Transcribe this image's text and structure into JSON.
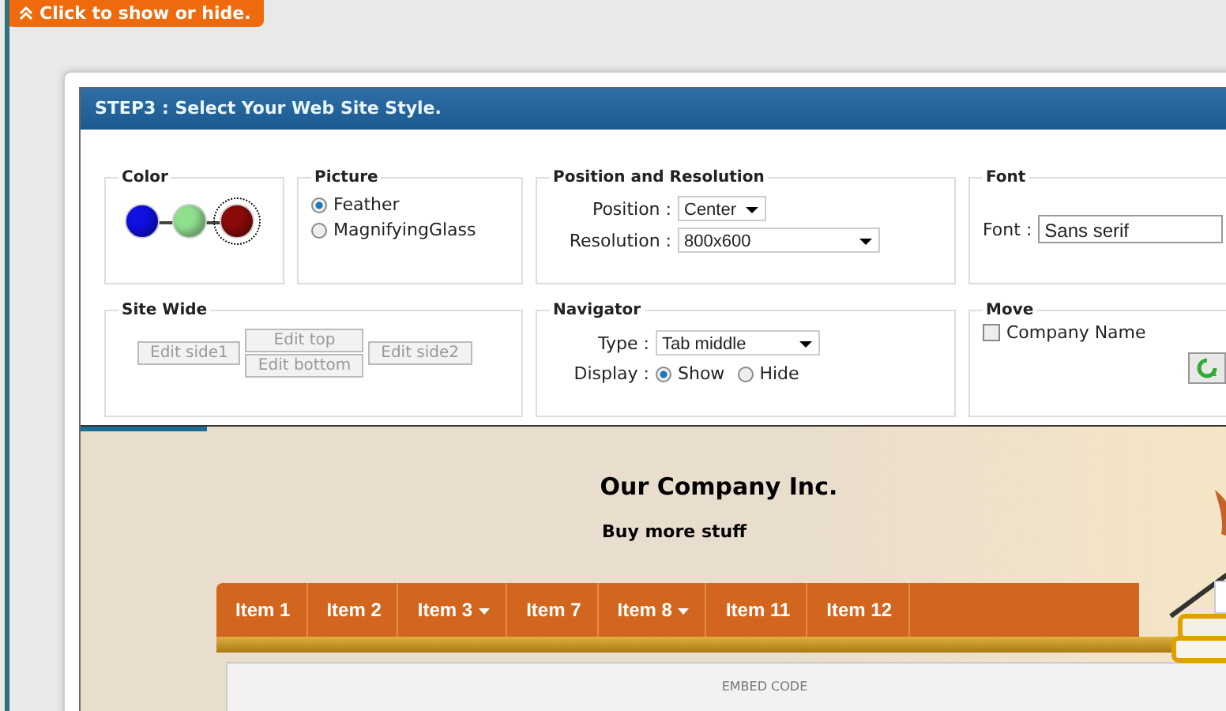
{
  "toggle_button": {
    "label": "Click to show or hide."
  },
  "dialog": {
    "title": "STEP3 : Select Your Web Site Style."
  },
  "color": {
    "legend": "Color",
    "swatches": [
      {
        "color": "#1010e0",
        "selected": false
      },
      {
        "color": "#90e090",
        "selected": false
      },
      {
        "color": "#8a0a0a",
        "selected": true
      }
    ]
  },
  "picture": {
    "legend": "Picture",
    "options": [
      {
        "label": "Feather",
        "selected": true
      },
      {
        "label": "MagnifyingGlass",
        "selected": false
      }
    ]
  },
  "position": {
    "legend": "Position and Resolution",
    "fields": [
      {
        "label": "Position :",
        "value": "Center"
      },
      {
        "label": "Resolution :",
        "value": "800x600"
      }
    ]
  },
  "font": {
    "legend": "Font",
    "label": "Font :",
    "value": "Sans serif"
  },
  "site_wide": {
    "legend": "Site Wide",
    "buttons": [
      "Edit side1",
      "Edit top",
      "Edit bottom",
      "Edit side2"
    ]
  },
  "navigator": {
    "legend": "Navigator",
    "type_label": "Type :",
    "type_value": "Tab middle",
    "display_label": "Display :",
    "display_options": [
      {
        "label": "Show",
        "selected": true
      },
      {
        "label": "Hide",
        "selected": false
      }
    ]
  },
  "move": {
    "legend": "Move",
    "checkbox": {
      "label": "Company Name",
      "checked": false
    }
  },
  "preview": {
    "title": "Our Company Inc.",
    "subtitle": "Buy more stuff",
    "menu": [
      {
        "label": "Item 1",
        "has_dropdown": false
      },
      {
        "label": "Item 2",
        "has_dropdown": false
      },
      {
        "label": "Item 3",
        "has_dropdown": true
      },
      {
        "label": "Item 7",
        "has_dropdown": false
      },
      {
        "label": "Item 8",
        "has_dropdown": true
      },
      {
        "label": "Item 11",
        "has_dropdown": false
      },
      {
        "label": "Item 12",
        "has_dropdown": false
      }
    ],
    "content_label": "EMBED CODE"
  }
}
